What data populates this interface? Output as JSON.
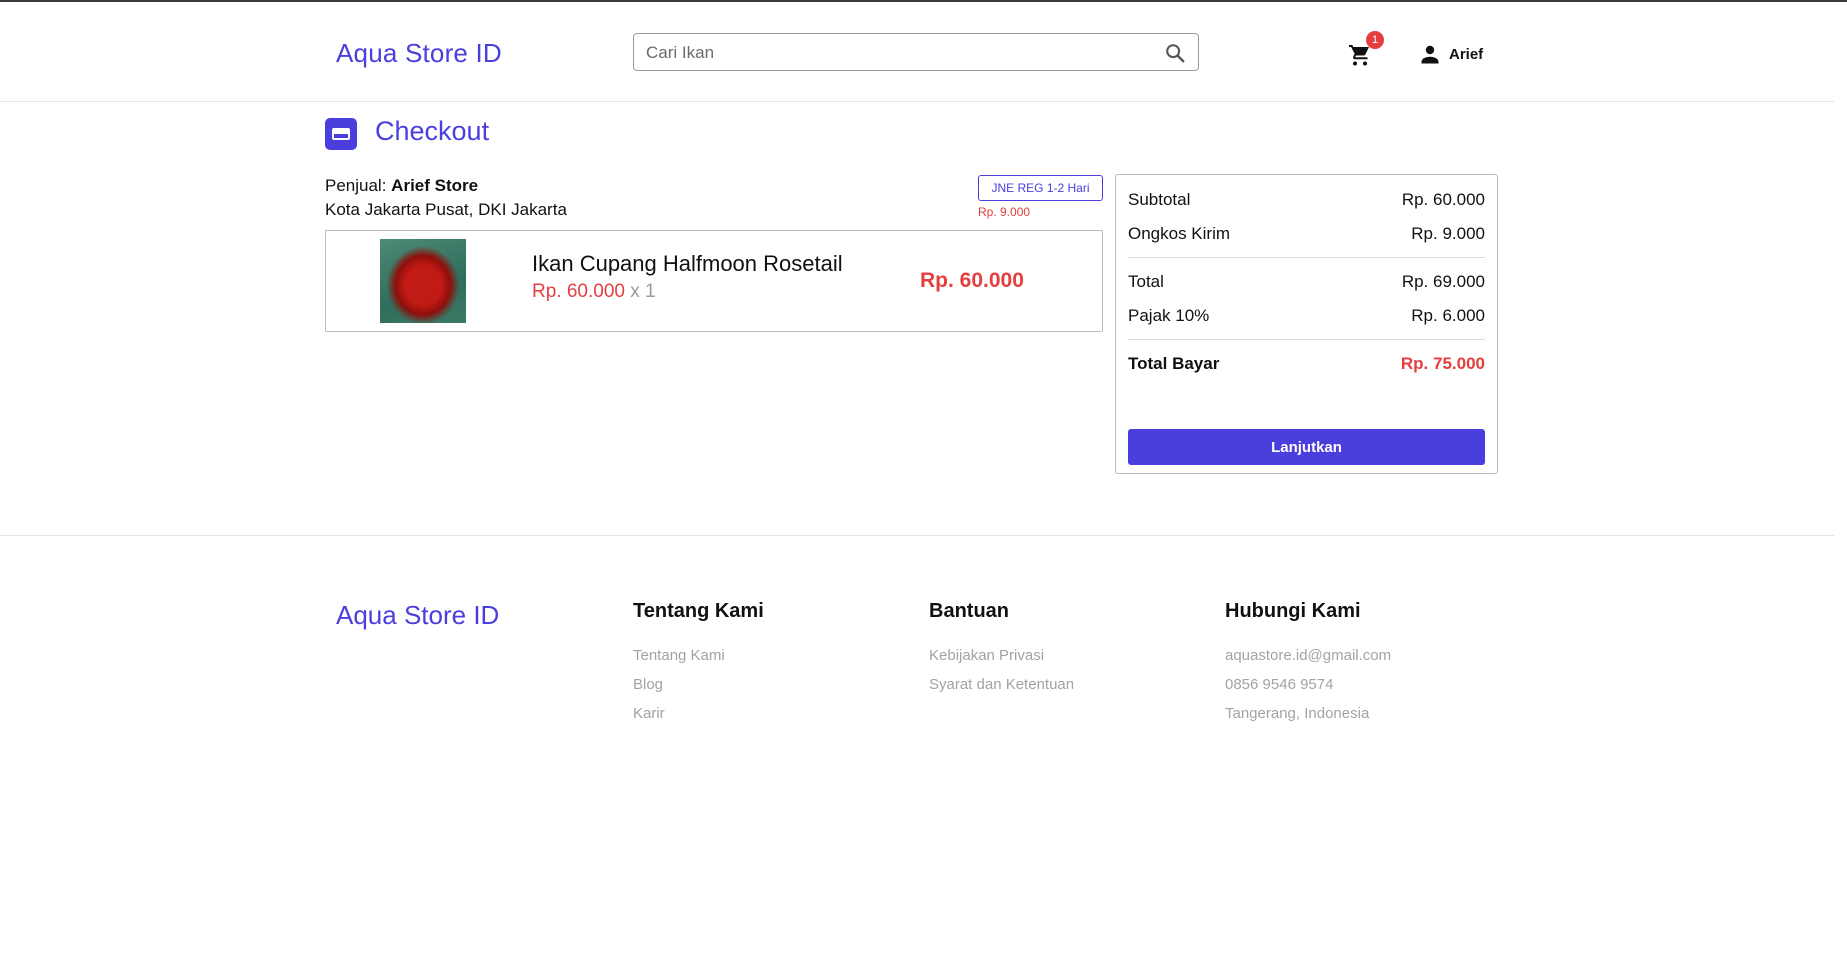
{
  "header": {
    "logo": "Aqua Store ID",
    "search_placeholder": "Cari Ikan",
    "cart_count": "1",
    "user_name": "Arief"
  },
  "checkout": {
    "title": "Checkout",
    "seller_prefix": "Penjual: ",
    "seller_name": "Arief Store",
    "seller_location": "Kota Jakarta Pusat, DKI Jakarta",
    "shipping_label": "JNE REG 1-2 Hari",
    "shipping_price": "Rp. 9.000",
    "item": {
      "name": "Ikan Cupang Halfmoon Rosetail",
      "price": "Rp. 60.000",
      "qty": " x 1",
      "total": "Rp. 60.000"
    }
  },
  "summary": {
    "subtotal_label": "Subtotal",
    "subtotal_value": "Rp. 60.000",
    "shipping_label": "Ongkos Kirim",
    "shipping_value": "Rp. 9.000",
    "total_label": "Total",
    "total_value": "Rp. 69.000",
    "tax_label": "Pajak 10%",
    "tax_value": "Rp. 6.000",
    "grand_label": "Total Bayar",
    "grand_value": "Rp. 75.000",
    "button": "Lanjutkan"
  },
  "footer": {
    "logo": "Aqua Store ID",
    "col1": {
      "title": "Tentang Kami",
      "links": [
        "Tentang Kami",
        "Blog",
        "Karir"
      ]
    },
    "col2": {
      "title": "Bantuan",
      "links": [
        "Kebijakan Privasi",
        "Syarat dan Ketentuan"
      ]
    },
    "col3": {
      "title": "Hubungi Kami",
      "links": [
        "aquastore.id@gmail.com",
        "0856 9546 9574",
        "Tangerang, Indonesia"
      ]
    }
  },
  "colors": {
    "brand": "#4a3fdc",
    "price": "#e53e3e"
  },
  "icons": [
    "search-icon",
    "cart-icon",
    "user-icon",
    "credit-card-icon"
  ]
}
